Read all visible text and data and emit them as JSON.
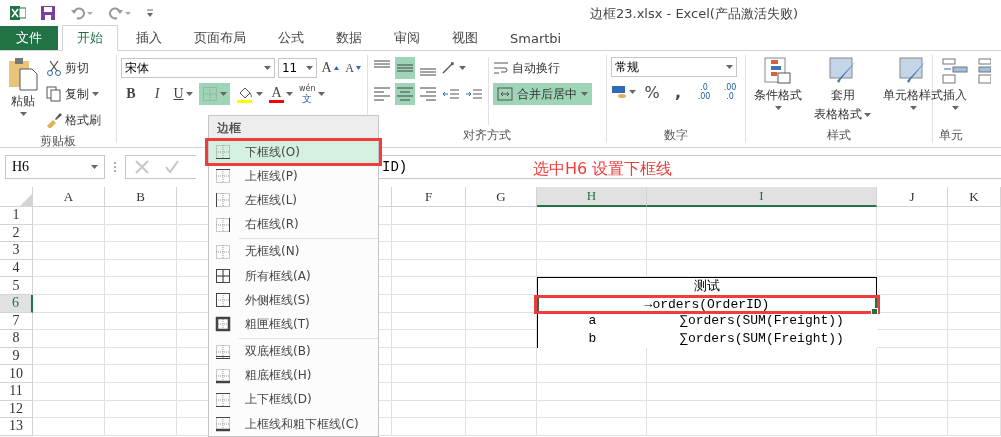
{
  "window": {
    "title": "边框23.xlsx - Excel(产品激活失败)"
  },
  "tabs": [
    {
      "label": "文件",
      "kind": "file",
      "selected": false
    },
    {
      "label": "开始",
      "kind": "tab",
      "selected": true
    },
    {
      "label": "插入",
      "kind": "tab",
      "selected": false
    },
    {
      "label": "页面布局",
      "kind": "tab",
      "selected": false
    },
    {
      "label": "公式",
      "kind": "tab",
      "selected": false
    },
    {
      "label": "数据",
      "kind": "tab",
      "selected": false
    },
    {
      "label": "审阅",
      "kind": "tab",
      "selected": false
    },
    {
      "label": "视图",
      "kind": "tab",
      "selected": false
    },
    {
      "label": "Smartbi",
      "kind": "tab",
      "selected": false
    }
  ],
  "clipboard": {
    "label": "剪贴板",
    "paste": "粘贴",
    "cut": "剪切",
    "copy": "复制",
    "format_painter": "格式刷"
  },
  "font": {
    "name": "宋体",
    "size": "11",
    "grow": "A",
    "shrink": "A",
    "bold": "B",
    "italic": "I",
    "underline": "U",
    "border_open": true,
    "font_color": "A",
    "phonetic_top": "wén",
    "phonetic_bottom": "文"
  },
  "alignment": {
    "label": "对齐方式",
    "vertical": [
      {
        "selected": false
      },
      {
        "selected": true
      },
      {
        "selected": false
      }
    ],
    "horizontal": [
      {
        "selected": false
      },
      {
        "selected": true
      },
      {
        "selected": false
      }
    ],
    "wrap": "自动换行",
    "merge": {
      "label": "合并后居中",
      "selected": true
    }
  },
  "number": {
    "label": "数字",
    "format": "常规",
    "percent": "%",
    "comma": ",",
    "increase_decimal": [
      ".0",
      ".00"
    ],
    "decrease_decimal": [
      ".00",
      ".0"
    ]
  },
  "styles": {
    "label": "样式",
    "conditional": "条件格式",
    "table_format": [
      "套用",
      "表格格式"
    ],
    "cell_styles": "单元格样式"
  },
  "cells": {
    "label": "单元",
    "insert": "插入"
  },
  "formula_bar": {
    "name_box": "H6",
    "formula": "ID)"
  },
  "annotation": "选中H6 设置下框线",
  "border_menu": {
    "title": "边框",
    "groups": [
      [
        {
          "label": "下框线(O)",
          "kind": "bottom",
          "selected": true,
          "annotated": true
        },
        {
          "label": "上框线(P)",
          "kind": "top",
          "selected": false,
          "annotated": false
        },
        {
          "label": "左框线(L)",
          "kind": "left",
          "selected": false,
          "annotated": false
        },
        {
          "label": "右框线(R)",
          "kind": "right",
          "selected": false,
          "annotated": false
        }
      ],
      [
        {
          "label": "无框线(N)",
          "kind": "none",
          "selected": false,
          "annotated": false
        },
        {
          "label": "所有框线(A)",
          "kind": "all",
          "selected": false,
          "annotated": false
        },
        {
          "label": "外侧框线(S)",
          "kind": "outside",
          "selected": false,
          "annotated": false
        },
        {
          "label": "粗匣框线(T)",
          "kind": "thick_box",
          "selected": false,
          "annotated": false
        }
      ],
      [
        {
          "label": "双底框线(B)",
          "kind": "double_bottom",
          "selected": false,
          "annotated": false
        },
        {
          "label": "粗底框线(H)",
          "kind": "thick_bottom",
          "selected": false,
          "annotated": false
        },
        {
          "label": "上下框线(D)",
          "kind": "top_bottom",
          "selected": false,
          "annotated": false
        },
        {
          "label": "上框线和粗下框线(C)",
          "kind": "top_thick_bottom",
          "selected": false,
          "annotated": false
        }
      ]
    ]
  },
  "sheet": {
    "columns": [
      {
        "label": "A",
        "selected": false
      },
      {
        "label": "B",
        "selected": false
      },
      {
        "label": "F",
        "selected": false
      },
      {
        "label": "G",
        "selected": false
      },
      {
        "label": "H",
        "selected": true
      },
      {
        "label": "I",
        "selected": true
      },
      {
        "label": "J",
        "selected": false
      },
      {
        "label": "K",
        "selected": false
      }
    ],
    "rows": [
      {
        "label": "1",
        "selected": false
      },
      {
        "label": "2",
        "selected": false
      },
      {
        "label": "3",
        "selected": false
      },
      {
        "label": "4",
        "selected": false
      },
      {
        "label": "5",
        "selected": false
      },
      {
        "label": "6",
        "selected": true
      },
      {
        "label": "7",
        "selected": false
      },
      {
        "label": "8",
        "selected": false
      },
      {
        "label": "9",
        "selected": false
      },
      {
        "label": "10",
        "selected": false
      },
      {
        "label": "11",
        "selected": false
      },
      {
        "label": "12",
        "selected": false
      },
      {
        "label": "13",
        "selected": false
      }
    ],
    "report": {
      "title": "测试",
      "field": {
        "text": "→orders(OrderID)",
        "selected": true,
        "annotated": true
      },
      "rows": [
        {
          "label": "a",
          "value": "∑orders(SUM(Freight))"
        },
        {
          "label": "b",
          "value": "∑orders(SUM(Freight))"
        }
      ]
    }
  }
}
